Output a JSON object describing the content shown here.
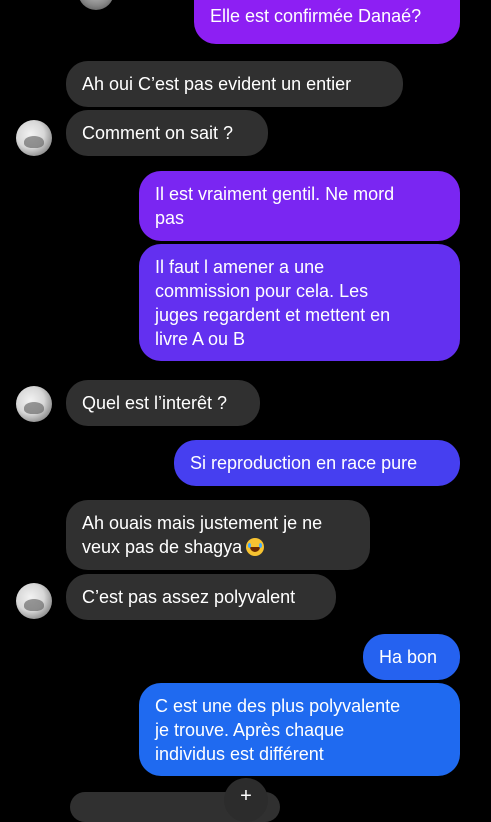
{
  "messages": [
    {
      "text": "Elle est confirmée Danaé?"
    },
    {
      "text": "Ah oui C’est  pas evident un entier"
    },
    {
      "text": "Comment on sait ?"
    },
    {
      "text": "Il est vraiment gentil.  Ne mord\npas"
    },
    {
      "text": "Il faut l amener a une\ncommission pour cela. Les\njuges regardent et mettent en\nlivre A ou B"
    },
    {
      "text": "Quel est l’interêt ?"
    },
    {
      "text": "Si reproduction en race pure"
    },
    {
      "text": "Ah ouais mais justement je ne\nveux pas de shagya"
    },
    {
      "text": "C’est pas assez polyvalent"
    },
    {
      "text": "Ha bon"
    },
    {
      "text": "C est  une des plus polyvalente\nje trouve. Après chaque\nindividus est différent"
    }
  ],
  "colors": {
    "background": "#000000",
    "incoming_bubble": "#303030",
    "outgoing_top": "#8d1ff3",
    "outgoing_mid": "#5a32f0",
    "outgoing_bottom": "#1f6af0"
  },
  "icons": {
    "laugh_emoji": "face-with-tears-of-joy-icon",
    "bottom_button": "plus-icon"
  }
}
